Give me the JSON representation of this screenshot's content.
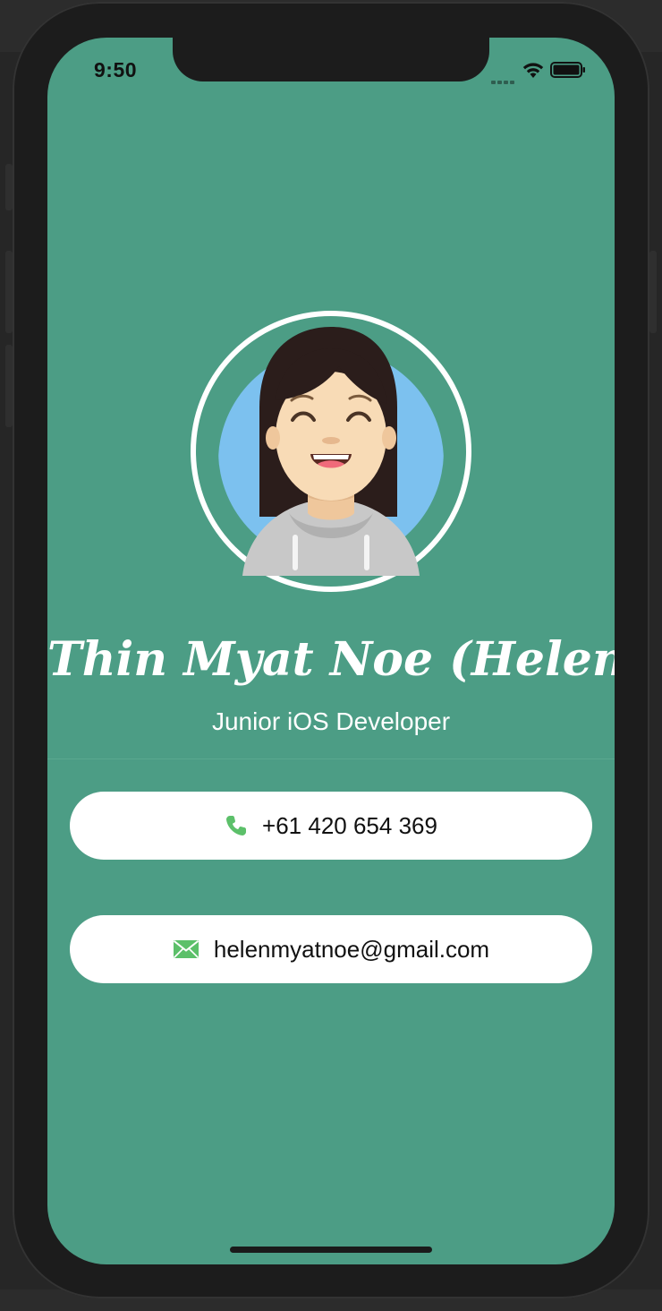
{
  "status_bar": {
    "time": "9:50",
    "icons": [
      "cellular-signal-icon",
      "wifi-icon",
      "battery-icon"
    ]
  },
  "profile": {
    "name": "Thin Myat Noe (Helen)",
    "title": "Junior iOS Developer",
    "avatar_icon": "smiling-girl-avatar"
  },
  "contacts": {
    "phone": {
      "icon": "phone-icon",
      "value": "+61 420 654 369"
    },
    "email": {
      "icon": "envelope-icon",
      "value": "helenmyatnoe@gmail.com"
    }
  },
  "colors": {
    "background": "#4c9d85",
    "pill": "#ffffff",
    "icon_green": "#5cc06a",
    "avatar_bg": "#7cc1ef"
  }
}
